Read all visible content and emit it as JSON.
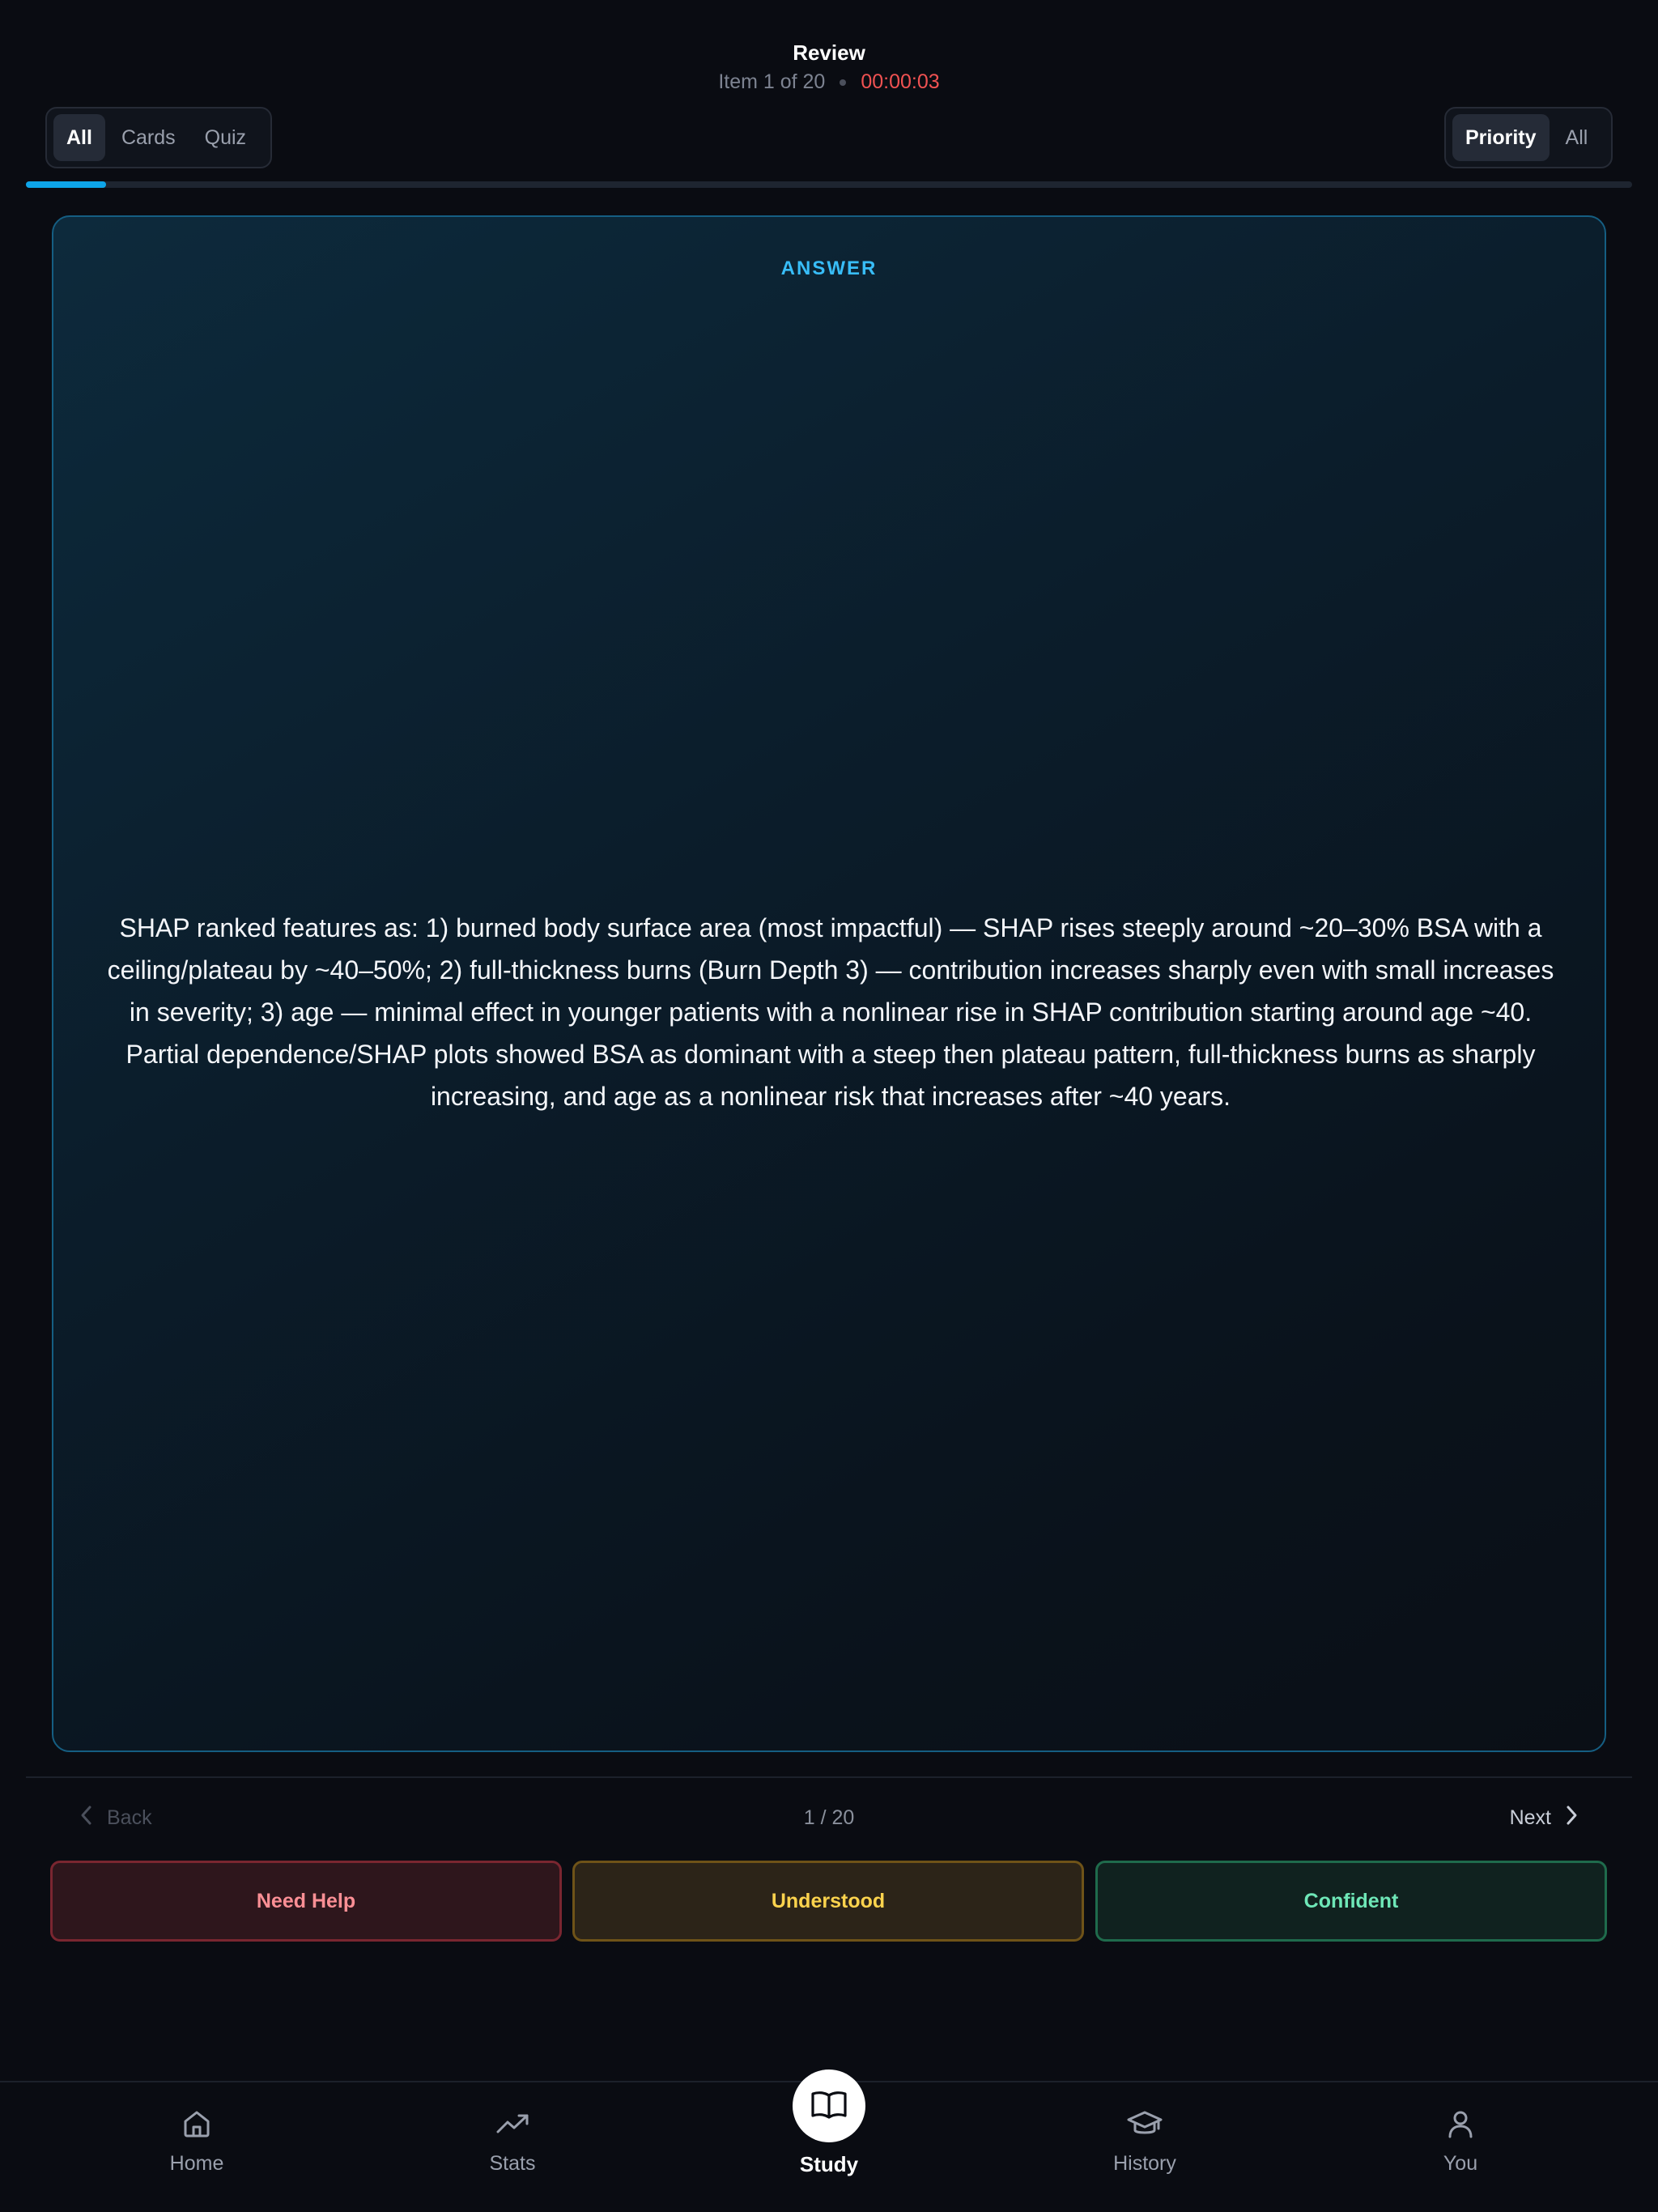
{
  "header": {
    "title": "Review",
    "item_progress": "Item 1 of 20",
    "timer": "00:00:03"
  },
  "filters": {
    "tabs": [
      "All",
      "Cards",
      "Quiz"
    ],
    "active_tab": "All",
    "sort": [
      "Priority",
      "All"
    ],
    "active_sort": "Priority"
  },
  "progress": {
    "fraction": 0.05
  },
  "card": {
    "label": "ANSWER",
    "text": "SHAP ranked features as: 1) burned body surface area (most impactful) — SHAP rises steeply around ~20–30% BSA with a ceiling/plateau by ~40–50%; 2) full-thickness burns (Burn Depth 3) — contribution increases sharply even with small increases in severity; 3) age — minimal effect in younger patients with a nonlinear rise in SHAP contribution starting around age ~40. Partial dependence/SHAP plots showed BSA as dominant with a steep then plateau pattern, full-thickness burns as sharply increasing, and age as a nonlinear risk that increases after ~40 years."
  },
  "nav": {
    "back_label": "Back",
    "pager": "1 / 20",
    "next_label": "Next"
  },
  "ratings": {
    "need_help": "Need Help",
    "understood": "Understood",
    "confident": "Confident"
  },
  "tabbar": {
    "home": "Home",
    "stats": "Stats",
    "study": "Study",
    "history": "History",
    "you": "You"
  },
  "colors": {
    "accent": "#0ea5e9",
    "timer": "#f05252",
    "need_help": "#fb8f95",
    "understood": "#fcd34d",
    "confident": "#6ee7b7"
  },
  "icons": {
    "back": "chevron-left-icon",
    "next": "chevron-right-icon",
    "home": "home-icon",
    "stats": "trending-up-icon",
    "study": "open-book-icon",
    "history": "graduation-cap-icon",
    "you": "user-icon"
  }
}
